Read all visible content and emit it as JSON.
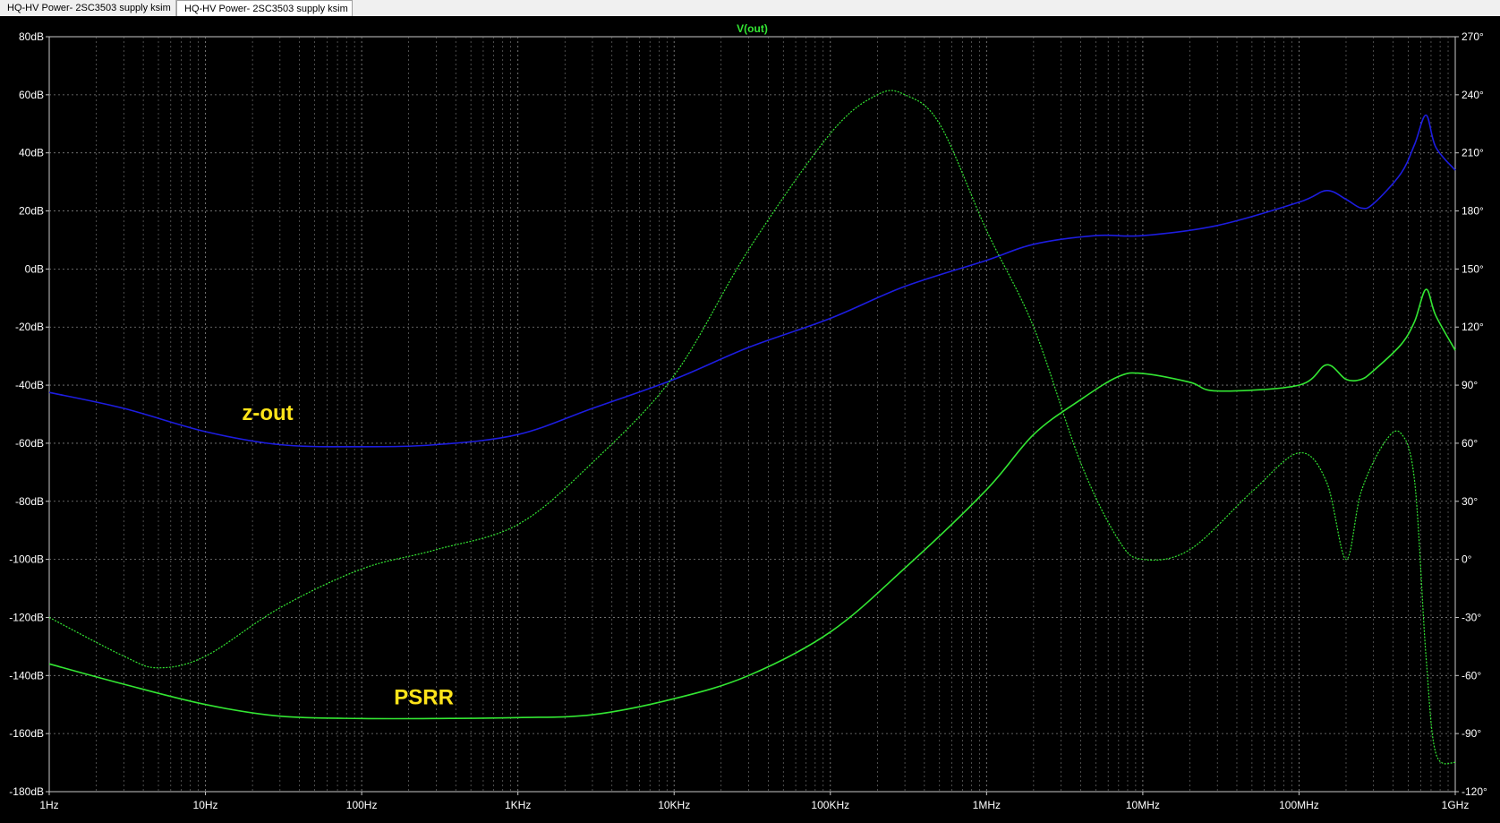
{
  "tabs": [
    {
      "label": "HQ-HV Power- 2SC3503 supply ksim",
      "icon": "schematic-icon"
    },
    {
      "label": "HQ-HV Power- 2SC3503 supply ksim",
      "icon": "waveform-icon",
      "active": true
    }
  ],
  "chart_data": {
    "type": "line",
    "title": "V(out)",
    "x_scale": "log",
    "xlim": [
      1,
      1000000000
    ],
    "x_ticks": [
      {
        "value": 1,
        "label": "1Hz"
      },
      {
        "value": 10,
        "label": "10Hz"
      },
      {
        "value": 100,
        "label": "100Hz"
      },
      {
        "value": 1000,
        "label": "1KHz"
      },
      {
        "value": 10000,
        "label": "10KHz"
      },
      {
        "value": 100000,
        "label": "100KHz"
      },
      {
        "value": 1000000,
        "label": "1MHz"
      },
      {
        "value": 10000000,
        "label": "10MHz"
      },
      {
        "value": 100000000,
        "label": "100MHz"
      },
      {
        "value": 1000000000,
        "label": "1GHz"
      }
    ],
    "ylim_left": [
      -180,
      80
    ],
    "y_left_ticks": [
      {
        "value": 80,
        "label": "80dB"
      },
      {
        "value": 60,
        "label": "60dB"
      },
      {
        "value": 40,
        "label": "40dB"
      },
      {
        "value": 20,
        "label": "20dB"
      },
      {
        "value": 0,
        "label": "0dB"
      },
      {
        "value": -20,
        "label": "-20dB"
      },
      {
        "value": -40,
        "label": "-40dB"
      },
      {
        "value": -60,
        "label": "-60dB"
      },
      {
        "value": -80,
        "label": "-80dB"
      },
      {
        "value": -100,
        "label": "-100dB"
      },
      {
        "value": -120,
        "label": "-120dB"
      },
      {
        "value": -140,
        "label": "-140dB"
      },
      {
        "value": -160,
        "label": "-160dB"
      },
      {
        "value": -180,
        "label": "-180dB"
      }
    ],
    "ylim_right": [
      -120,
      270
    ],
    "y_right_ticks": [
      {
        "value": 270,
        "label": "270°"
      },
      {
        "value": 240,
        "label": "240°"
      },
      {
        "value": 210,
        "label": "210°"
      },
      {
        "value": 180,
        "label": "180°"
      },
      {
        "value": 150,
        "label": "150°"
      },
      {
        "value": 120,
        "label": "120°"
      },
      {
        "value": 90,
        "label": "90°"
      },
      {
        "value": 60,
        "label": "60°"
      },
      {
        "value": 30,
        "label": "30°"
      },
      {
        "value": 0,
        "label": "0°"
      },
      {
        "value": -30,
        "label": "-30°"
      },
      {
        "value": -60,
        "label": "-60°"
      },
      {
        "value": -90,
        "label": "-90°"
      },
      {
        "value": -120,
        "label": "-120°"
      }
    ],
    "grid": true,
    "colors": {
      "background": "#000000",
      "grid": "#7f7f7f",
      "axis_text": "#ffffff",
      "zout": "#1d1de0",
      "psrr": "#33e633",
      "title": "#33e633",
      "annotation": "#ffe41a"
    },
    "annotations": [
      {
        "text": "z-out",
        "x": 25,
        "y": -52
      },
      {
        "text": "PSRR",
        "x": 250,
        "y": -150
      }
    ],
    "series": [
      {
        "id": "zout-magnitude",
        "axis": "left",
        "style": "solid",
        "color": "#1d1de0",
        "points": [
          [
            1,
            -42.5
          ],
          [
            3,
            -48
          ],
          [
            10,
            -56
          ],
          [
            30,
            -60.5
          ],
          [
            100,
            -61.2
          ],
          [
            300,
            -60.5
          ],
          [
            1000,
            -57
          ],
          [
            3000,
            -48
          ],
          [
            10000,
            -38
          ],
          [
            30000,
            -27
          ],
          [
            100000,
            -17
          ],
          [
            300000,
            -6
          ],
          [
            1000000,
            3
          ],
          [
            2000000,
            8.5
          ],
          [
            5000000,
            11.5
          ],
          [
            10000000,
            11.5
          ],
          [
            30000000,
            15
          ],
          [
            100000000,
            23
          ],
          [
            150000000,
            27
          ],
          [
            200000000,
            24
          ],
          [
            250000000,
            21
          ],
          [
            300000000,
            22.5
          ],
          [
            450000000,
            33
          ],
          [
            550000000,
            43
          ],
          [
            650000000,
            53
          ],
          [
            750000000,
            42
          ],
          [
            1000000000,
            34
          ]
        ]
      },
      {
        "id": "psrr-magnitude",
        "axis": "left",
        "style": "solid",
        "color": "#33e633",
        "points": [
          [
            1,
            -136
          ],
          [
            3,
            -143
          ],
          [
            10,
            -150
          ],
          [
            30,
            -154
          ],
          [
            100,
            -154.8
          ],
          [
            300,
            -154.8
          ],
          [
            1000,
            -154.5
          ],
          [
            3000,
            -153.5
          ],
          [
            10000,
            -148
          ],
          [
            30000,
            -140
          ],
          [
            100000,
            -125
          ],
          [
            300000,
            -103
          ],
          [
            1000000,
            -76
          ],
          [
            2000000,
            -57
          ],
          [
            4000000,
            -45
          ],
          [
            7000000,
            -37
          ],
          [
            10000000,
            -36
          ],
          [
            20000000,
            -39
          ],
          [
            30000000,
            -42
          ],
          [
            100000000,
            -40
          ],
          [
            150000000,
            -33
          ],
          [
            200000000,
            -38
          ],
          [
            250000000,
            -38
          ],
          [
            300000000,
            -35
          ],
          [
            450000000,
            -26
          ],
          [
            550000000,
            -18
          ],
          [
            650000000,
            -7
          ],
          [
            750000000,
            -16
          ],
          [
            1000000000,
            -28
          ]
        ]
      },
      {
        "id": "zout-phase",
        "axis": "right",
        "style": "dashed",
        "color": "#33e633",
        "points": [
          [
            1,
            -30
          ],
          [
            3,
            -50
          ],
          [
            5,
            -56
          ],
          [
            10,
            -50
          ],
          [
            30,
            -25
          ],
          [
            100,
            -5
          ],
          [
            300,
            5
          ],
          [
            1000,
            18
          ],
          [
            3000,
            50
          ],
          [
            10000,
            95
          ],
          [
            30000,
            160
          ],
          [
            100000,
            220
          ],
          [
            200000,
            240
          ],
          [
            300000,
            240
          ],
          [
            500000,
            225
          ],
          [
            1000000,
            170
          ],
          [
            2000000,
            120
          ],
          [
            4000000,
            50
          ],
          [
            7000000,
            10
          ],
          [
            10000000,
            0
          ],
          [
            20000000,
            5
          ],
          [
            50000000,
            35
          ],
          [
            100000000,
            55
          ],
          [
            150000000,
            40
          ],
          [
            200000000,
            0
          ],
          [
            250000000,
            35
          ],
          [
            350000000,
            60
          ],
          [
            450000000,
            65
          ],
          [
            550000000,
            40
          ],
          [
            650000000,
            -50
          ],
          [
            750000000,
            -100
          ],
          [
            1000000000,
            -105
          ]
        ]
      },
      {
        "id": "psrr-phase",
        "axis": "right",
        "style": "dashed",
        "color": "#33e633",
        "points": [
          [
            1,
            -30
          ],
          [
            3,
            -50
          ],
          [
            5,
            -56
          ],
          [
            10,
            -50
          ],
          [
            30,
            -25
          ],
          [
            100,
            -5
          ],
          [
            300,
            5
          ],
          [
            1000,
            18
          ],
          [
            3000,
            50
          ],
          [
            10000,
            95
          ],
          [
            30000,
            160
          ],
          [
            100000,
            220
          ],
          [
            200000,
            240
          ],
          [
            300000,
            240
          ],
          [
            500000,
            225
          ],
          [
            1000000,
            170
          ],
          [
            2000000,
            120
          ],
          [
            4000000,
            50
          ],
          [
            7000000,
            10
          ],
          [
            10000000,
            0
          ],
          [
            20000000,
            5
          ],
          [
            50000000,
            35
          ],
          [
            100000000,
            55
          ],
          [
            150000000,
            40
          ],
          [
            200000000,
            0
          ],
          [
            250000000,
            35
          ],
          [
            350000000,
            60
          ],
          [
            450000000,
            65
          ],
          [
            550000000,
            40
          ],
          [
            650000000,
            -50
          ],
          [
            750000000,
            -100
          ],
          [
            1000000000,
            -105
          ]
        ]
      }
    ]
  }
}
